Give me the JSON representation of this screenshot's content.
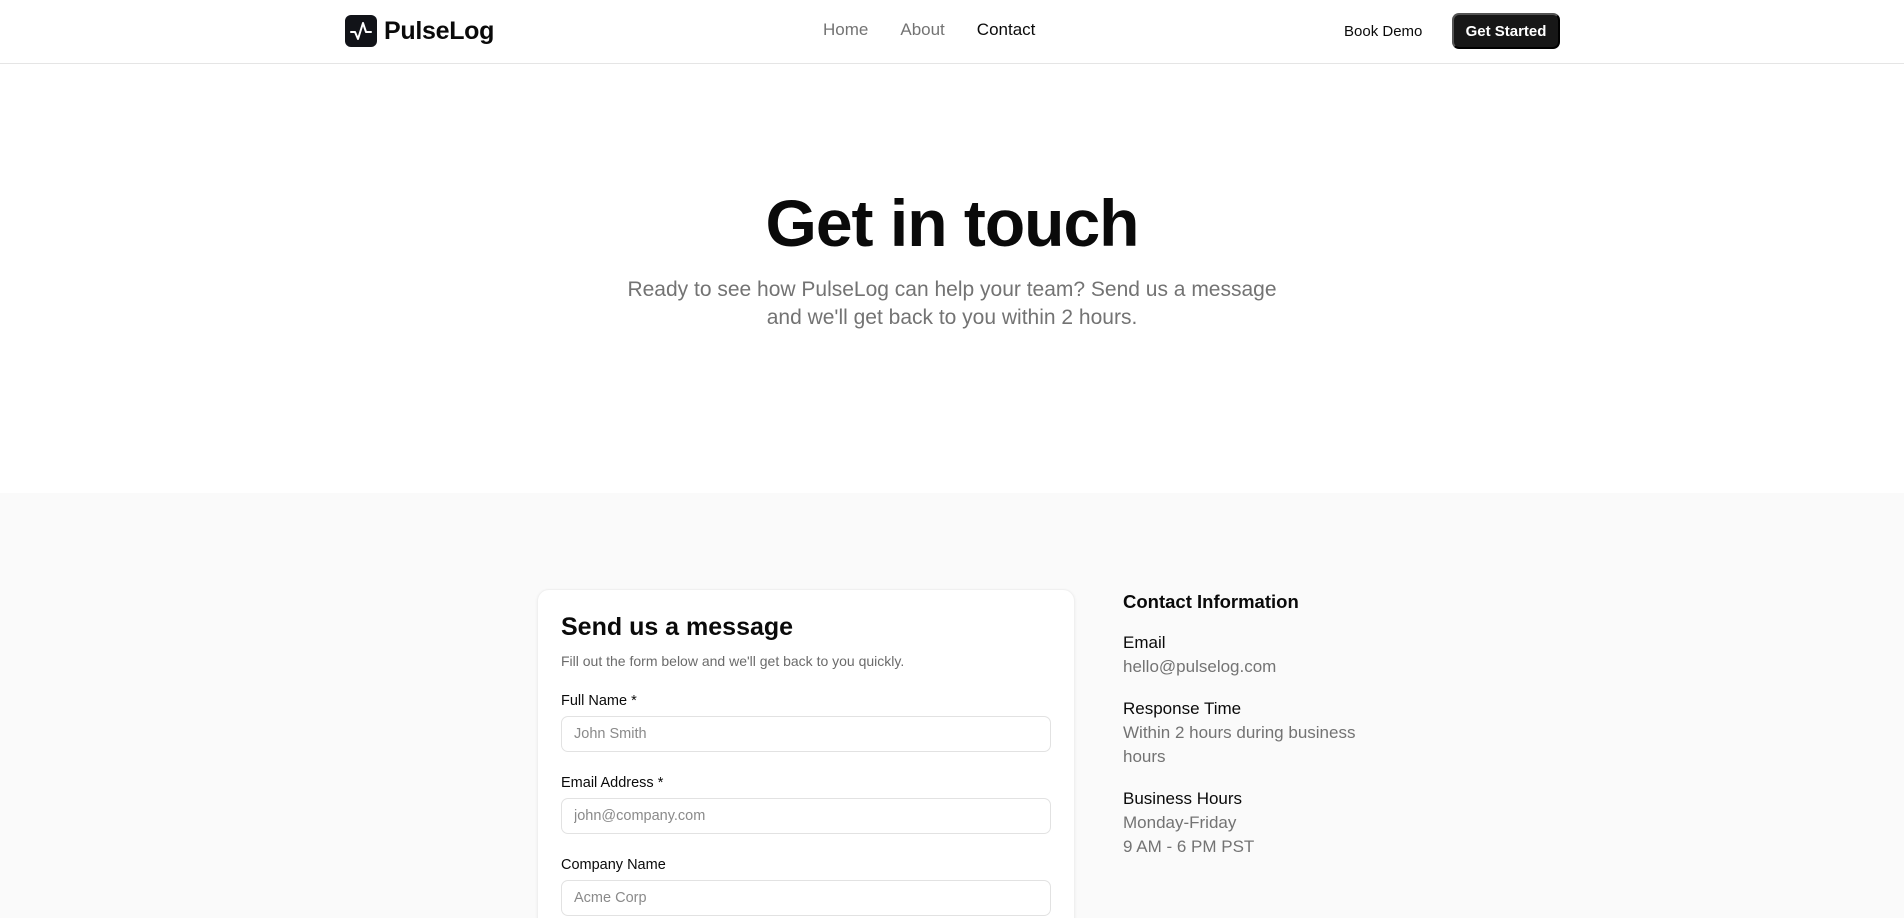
{
  "brand": {
    "name": "PulseLog",
    "logo_icon": "pulse-icon"
  },
  "nav": {
    "items": [
      {
        "label": "Home"
      },
      {
        "label": "About"
      },
      {
        "label": "Contact"
      }
    ],
    "active": "Contact"
  },
  "header": {
    "book_demo_label": "Book Demo",
    "get_started_label": "Get Started"
  },
  "hero": {
    "title": "Get in touch",
    "subtitle": "Ready to see how PulseLog can help your team? Send us a message and we'll get back to you within 2 hours."
  },
  "form": {
    "title": "Send us a message",
    "description": "Fill out the form below and we'll get back to you quickly.",
    "fields": [
      {
        "label": "Full Name *",
        "placeholder": "John Smith",
        "value": ""
      },
      {
        "label": "Email Address *",
        "placeholder": "john@company.com",
        "value": ""
      },
      {
        "label": "Company Name",
        "placeholder": "Acme Corp",
        "value": ""
      }
    ]
  },
  "contact_info": {
    "heading": "Contact Information",
    "email": {
      "label": "Email",
      "value": "hello@pulselog.com"
    },
    "response_time": {
      "label": "Response Time",
      "value": "Within 2 hours during business hours"
    },
    "business_hours": {
      "label": "Business Hours",
      "line1": "Monday-Friday",
      "line2": "9 AM - 6 PM PST"
    }
  },
  "colors": {
    "primary": "#171717",
    "muted": "#737373",
    "section_bg": "#fafafa",
    "border": "#e5e5e5"
  }
}
